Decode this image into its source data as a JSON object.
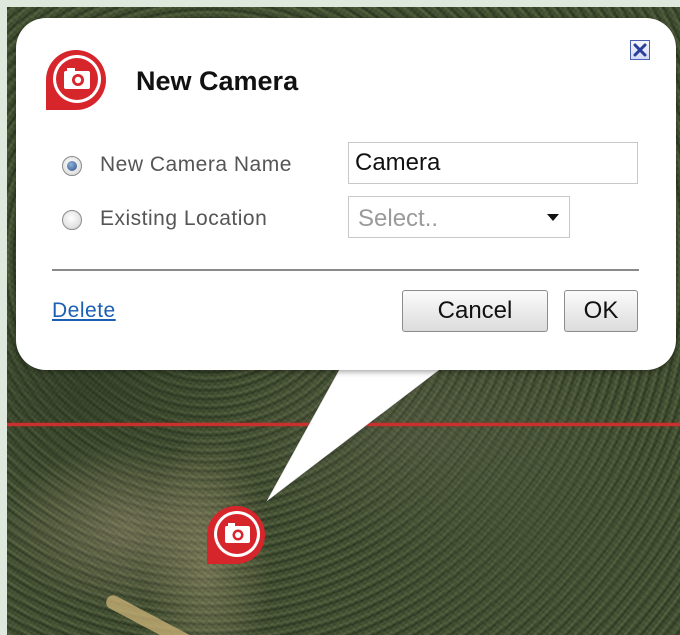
{
  "dialog": {
    "title": "New Camera",
    "header_icon": "camera-icon",
    "close_icon": "close-icon"
  },
  "form": {
    "option_new": {
      "label": "New Camera Name",
      "checked": true
    },
    "option_existing": {
      "label": "Existing Location",
      "checked": false
    },
    "name_input": {
      "value": "Camera"
    },
    "location_select": {
      "selected": "Select.."
    }
  },
  "actions": {
    "delete_label": "Delete",
    "cancel_label": "Cancel",
    "ok_label": "OK"
  },
  "map": {
    "marker_icon": "camera-icon",
    "boundary_color": "#c8312d"
  },
  "colors": {
    "accent": "#d7262b",
    "link": "#1a5fb4"
  }
}
